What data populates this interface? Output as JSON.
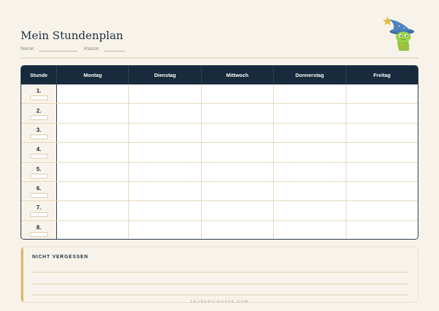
{
  "header": {
    "title": "Mein Stundenplan",
    "name_label": "Name:",
    "klasse_label": "Klasse:"
  },
  "mascot": {
    "icon": "wizard-giraffe-icon"
  },
  "table": {
    "first_col_label": "Stunde",
    "days": [
      "Montag",
      "Dienstag",
      "Mittwoch",
      "Donnerstag",
      "Freitag"
    ],
    "periods": [
      "1.",
      "2.",
      "3.",
      "4.",
      "5.",
      "6.",
      "7.",
      "8."
    ]
  },
  "notes": {
    "heading": "NICHT VERGESSEN"
  },
  "footer": {
    "text": "ZAUBERGIRAFFE.COM"
  },
  "colors": {
    "navy": "#172b3c",
    "cream": "#f8f3ea",
    "gold_accent": "#d7b95c",
    "grid_line": "#e3d6bc"
  }
}
